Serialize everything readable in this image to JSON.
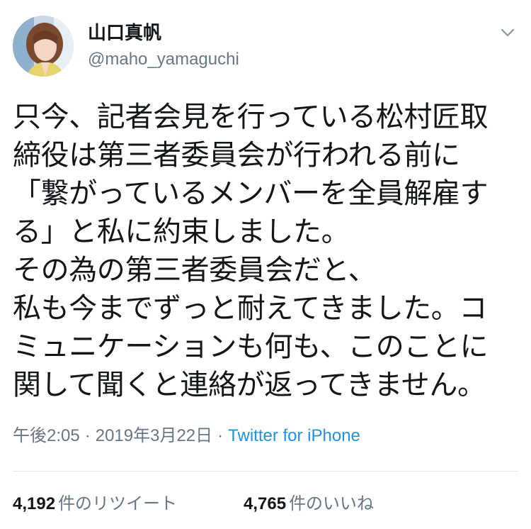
{
  "user": {
    "display_name": "山口真帆",
    "handle": "@maho_yamaguchi"
  },
  "tweet": {
    "lines": [
      "只今、記者会見を行っている松村匠取",
      "締役は第三者委員会が行われる前に",
      "「繋がっているメンバーを全員解雇す",
      "る」と私に約束しました。",
      "その為の第三者委員会だと、",
      "私も今までずっと耐えてきました。コ",
      "ミュニケーションも何も、このことに",
      "関して聞くと連絡が返ってきません。"
    ]
  },
  "meta": {
    "time": "午後2:05",
    "separator": "·",
    "date": "2019年3月22日",
    "source": "Twitter for iPhone"
  },
  "stats": {
    "retweets_count": "4,192",
    "retweets_label": "件のリツイート",
    "likes_count": "4,765",
    "likes_label": "件のいいね"
  },
  "icons": {
    "menu": "chevron-down-icon",
    "avatar": "profile-photo"
  },
  "colors": {
    "text": "#14171a",
    "secondary": "#657786",
    "link": "#1b95e0",
    "divider": "#e1e8ed"
  }
}
